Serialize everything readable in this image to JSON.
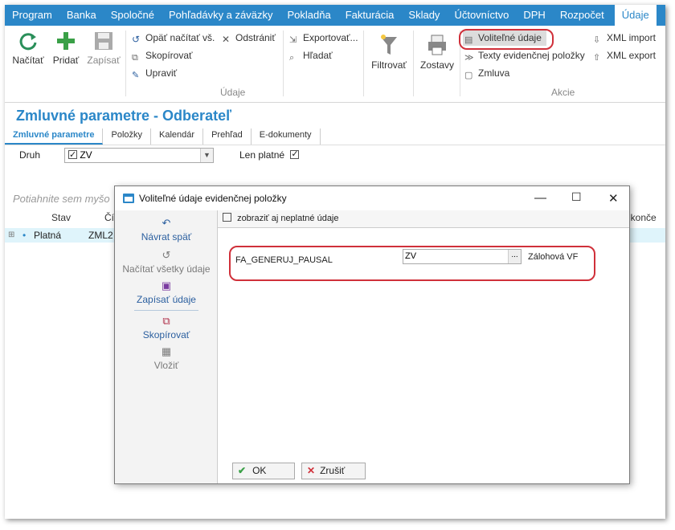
{
  "menubar": {
    "items": [
      "Program",
      "Banka",
      "Spoločné",
      "Pohľadávky a záväzky",
      "Pokladňa",
      "Fakturácia",
      "Sklady",
      "Účtovníctvo",
      "DPH",
      "Rozpočet",
      "Údaje"
    ],
    "active": "Údaje"
  },
  "ribbon": {
    "nacitat": "Načítať",
    "pridat": "Pridať",
    "zapisat": "Zapísať",
    "opat_nacitat": "Opäť načítať vš.",
    "odstranit": "Odstrániť",
    "skopirovat": "Skopírovať",
    "upravit": "Upraviť",
    "exportovat": "Exportovať...",
    "hladat": "Hľadať",
    "filtrovat": "Filtrovať",
    "zostavy": "Zostavy",
    "volitelne_udaje": "Voliteľné údaje",
    "texty": "Texty evidenčnej položky",
    "zmluva": "Zmluva",
    "xml_import": "XML import",
    "xml_export": "XML export",
    "group_udaje": "Údaje",
    "group_akcie": "Akcie"
  },
  "page": {
    "title": "Zmluvné parametre - Odberateľ",
    "tabs": [
      "Zmluvné parametre",
      "Položky",
      "Kalendár",
      "Prehľad",
      "E-dokumenty"
    ]
  },
  "filter": {
    "druh_label": "Druh",
    "druh_value": "ZV",
    "len_platne_label": "Len platné",
    "len_platne_checked": true
  },
  "grid": {
    "group_hint": "Potiahnite sem myšo",
    "col_stav": "Stav",
    "col_c": "Čí",
    "col_right": "ukonče",
    "row": {
      "expand": "⊞",
      "dot": "•",
      "stav": "Platná",
      "num": "ZML2"
    }
  },
  "dialog": {
    "title": "Voliteľné údaje evidenčnej položky",
    "side": {
      "navrat": "Návrat späť",
      "nacitat_vsetky": "Načítať všetky údaje",
      "zapisat": "Zapísať údaje",
      "skopirovat": "Skopírovať",
      "vlozit": "Vložiť"
    },
    "show_invalid": "zobraziť aj neplatné údaje",
    "field_name": "FA_GENERUJ_PAUSAL",
    "field_value": "ZV",
    "field_btn": "...",
    "field_desc": "Zálohová VF",
    "ok": "OK",
    "cancel": "Zrušiť"
  },
  "colors": {
    "accent": "#2b87c8",
    "highlight": "#d0303a"
  }
}
